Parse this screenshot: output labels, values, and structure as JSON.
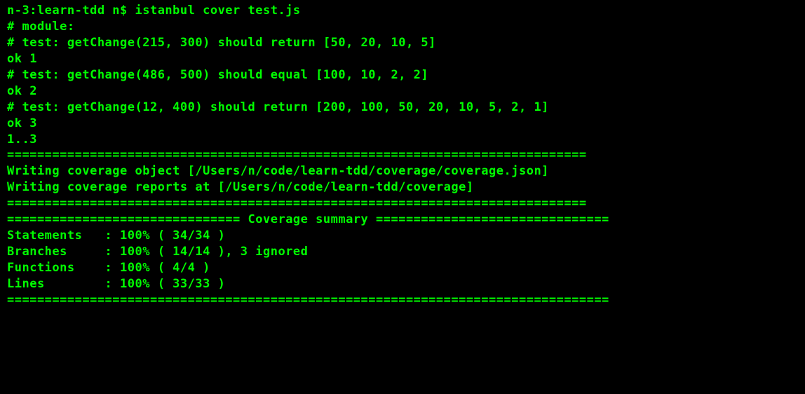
{
  "lines": {
    "prompt": "n-3:learn-tdd n$ istanbul cover test.js",
    "module_header": "# module:",
    "test1": "# test: getChange(215, 300) should return [50, 20, 10, 5]",
    "ok1": "ok 1",
    "test2": "# test: getChange(486, 500) should equal [100, 10, 2, 2]",
    "ok2": "ok 2",
    "test3": "# test: getChange(12, 400) should return [200, 100, 50, 20, 10, 5, 2, 1]",
    "ok3": "ok 3",
    "range": "1..3",
    "divider1": "=============================================================================",
    "writing1": "Writing coverage object [/Users/n/code/learn-tdd/coverage/coverage.json]",
    "writing2": "Writing coverage reports at [/Users/n/code/learn-tdd/coverage]",
    "divider2": "=============================================================================",
    "blank": "",
    "summary_header": "=============================== Coverage summary ===============================",
    "statements": "Statements   : 100% ( 34/34 )",
    "branches": "Branches     : 100% ( 14/14 ), 3 ignored",
    "functions": "Functions    : 100% ( 4/4 )",
    "lines_stat": "Lines        : 100% ( 33/33 )",
    "divider3": "================================================================================"
  }
}
